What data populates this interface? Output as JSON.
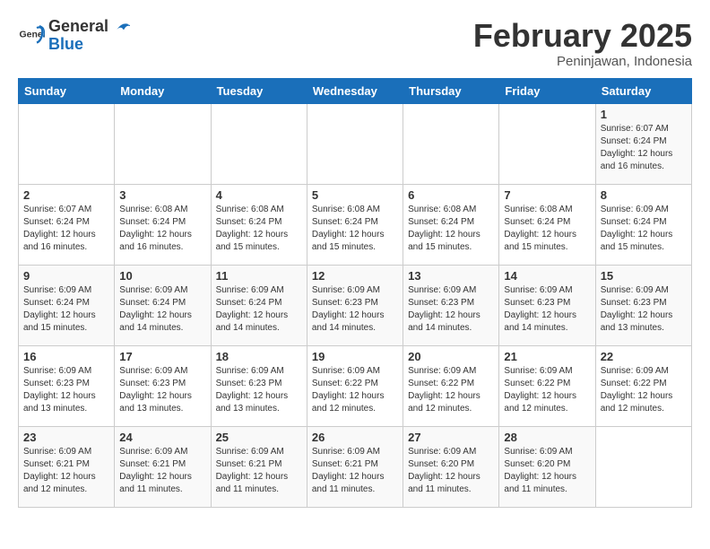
{
  "header": {
    "logo_general": "General",
    "logo_blue": "Blue",
    "title": "February 2025",
    "subtitle": "Peninjawan, Indonesia"
  },
  "days_of_week": [
    "Sunday",
    "Monday",
    "Tuesday",
    "Wednesday",
    "Thursday",
    "Friday",
    "Saturday"
  ],
  "weeks": [
    [
      {
        "day": "",
        "info": ""
      },
      {
        "day": "",
        "info": ""
      },
      {
        "day": "",
        "info": ""
      },
      {
        "day": "",
        "info": ""
      },
      {
        "day": "",
        "info": ""
      },
      {
        "day": "",
        "info": ""
      },
      {
        "day": "1",
        "info": "Sunrise: 6:07 AM\nSunset: 6:24 PM\nDaylight: 12 hours\nand 16 minutes."
      }
    ],
    [
      {
        "day": "2",
        "info": "Sunrise: 6:07 AM\nSunset: 6:24 PM\nDaylight: 12 hours\nand 16 minutes."
      },
      {
        "day": "3",
        "info": "Sunrise: 6:08 AM\nSunset: 6:24 PM\nDaylight: 12 hours\nand 16 minutes."
      },
      {
        "day": "4",
        "info": "Sunrise: 6:08 AM\nSunset: 6:24 PM\nDaylight: 12 hours\nand 15 minutes."
      },
      {
        "day": "5",
        "info": "Sunrise: 6:08 AM\nSunset: 6:24 PM\nDaylight: 12 hours\nand 15 minutes."
      },
      {
        "day": "6",
        "info": "Sunrise: 6:08 AM\nSunset: 6:24 PM\nDaylight: 12 hours\nand 15 minutes."
      },
      {
        "day": "7",
        "info": "Sunrise: 6:08 AM\nSunset: 6:24 PM\nDaylight: 12 hours\nand 15 minutes."
      },
      {
        "day": "8",
        "info": "Sunrise: 6:09 AM\nSunset: 6:24 PM\nDaylight: 12 hours\nand 15 minutes."
      }
    ],
    [
      {
        "day": "9",
        "info": "Sunrise: 6:09 AM\nSunset: 6:24 PM\nDaylight: 12 hours\nand 15 minutes."
      },
      {
        "day": "10",
        "info": "Sunrise: 6:09 AM\nSunset: 6:24 PM\nDaylight: 12 hours\nand 14 minutes."
      },
      {
        "day": "11",
        "info": "Sunrise: 6:09 AM\nSunset: 6:24 PM\nDaylight: 12 hours\nand 14 minutes."
      },
      {
        "day": "12",
        "info": "Sunrise: 6:09 AM\nSunset: 6:23 PM\nDaylight: 12 hours\nand 14 minutes."
      },
      {
        "day": "13",
        "info": "Sunrise: 6:09 AM\nSunset: 6:23 PM\nDaylight: 12 hours\nand 14 minutes."
      },
      {
        "day": "14",
        "info": "Sunrise: 6:09 AM\nSunset: 6:23 PM\nDaylight: 12 hours\nand 14 minutes."
      },
      {
        "day": "15",
        "info": "Sunrise: 6:09 AM\nSunset: 6:23 PM\nDaylight: 12 hours\nand 13 minutes."
      }
    ],
    [
      {
        "day": "16",
        "info": "Sunrise: 6:09 AM\nSunset: 6:23 PM\nDaylight: 12 hours\nand 13 minutes."
      },
      {
        "day": "17",
        "info": "Sunrise: 6:09 AM\nSunset: 6:23 PM\nDaylight: 12 hours\nand 13 minutes."
      },
      {
        "day": "18",
        "info": "Sunrise: 6:09 AM\nSunset: 6:23 PM\nDaylight: 12 hours\nand 13 minutes."
      },
      {
        "day": "19",
        "info": "Sunrise: 6:09 AM\nSunset: 6:22 PM\nDaylight: 12 hours\nand 12 minutes."
      },
      {
        "day": "20",
        "info": "Sunrise: 6:09 AM\nSunset: 6:22 PM\nDaylight: 12 hours\nand 12 minutes."
      },
      {
        "day": "21",
        "info": "Sunrise: 6:09 AM\nSunset: 6:22 PM\nDaylight: 12 hours\nand 12 minutes."
      },
      {
        "day": "22",
        "info": "Sunrise: 6:09 AM\nSunset: 6:22 PM\nDaylight: 12 hours\nand 12 minutes."
      }
    ],
    [
      {
        "day": "23",
        "info": "Sunrise: 6:09 AM\nSunset: 6:21 PM\nDaylight: 12 hours\nand 12 minutes."
      },
      {
        "day": "24",
        "info": "Sunrise: 6:09 AM\nSunset: 6:21 PM\nDaylight: 12 hours\nand 11 minutes."
      },
      {
        "day": "25",
        "info": "Sunrise: 6:09 AM\nSunset: 6:21 PM\nDaylight: 12 hours\nand 11 minutes."
      },
      {
        "day": "26",
        "info": "Sunrise: 6:09 AM\nSunset: 6:21 PM\nDaylight: 12 hours\nand 11 minutes."
      },
      {
        "day": "27",
        "info": "Sunrise: 6:09 AM\nSunset: 6:20 PM\nDaylight: 12 hours\nand 11 minutes."
      },
      {
        "day": "28",
        "info": "Sunrise: 6:09 AM\nSunset: 6:20 PM\nDaylight: 12 hours\nand 11 minutes."
      },
      {
        "day": "",
        "info": ""
      }
    ]
  ]
}
